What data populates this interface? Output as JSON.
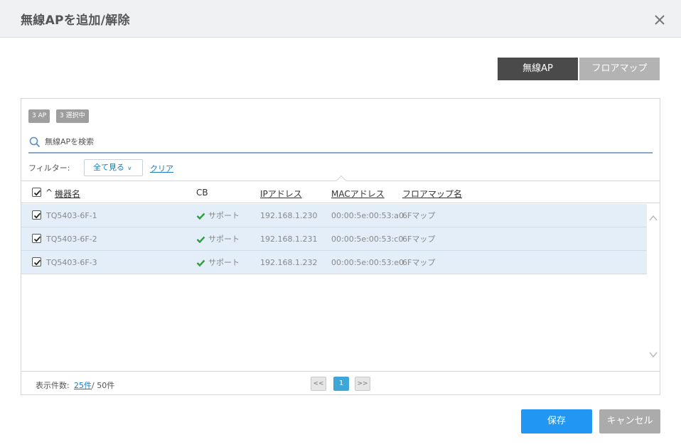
{
  "dialog": {
    "title": "無線APを追加/解除"
  },
  "tabs": [
    {
      "label": "無線AP",
      "active": true
    },
    {
      "label": "フロアマップ",
      "active": false
    }
  ],
  "badges": {
    "count": "3 AP",
    "selected": "3 選択中"
  },
  "search": {
    "placeholder": "無線APを検索",
    "value": ""
  },
  "filter": {
    "label": "フィルター:",
    "selected": "全て見る",
    "clear": "クリア"
  },
  "table": {
    "sort_indicator": "^",
    "columns": {
      "name": "機器名",
      "cb": "CB",
      "ip": "IPアドレス",
      "mac": "MACアドレス",
      "floormap": "フロアマップ名"
    },
    "rows": [
      {
        "checked": true,
        "name": "TQ5403-6F-1",
        "cb": "サポート",
        "ip": "192.168.1.230",
        "mac": "00:00:5e:00:53:a0",
        "floormap": "6Fマップ"
      },
      {
        "checked": true,
        "name": "TQ5403-6F-2",
        "cb": "サポート",
        "ip": "192.168.1.231",
        "mac": "00:00:5e:00:53:c0",
        "floormap": "6Fマップ"
      },
      {
        "checked": true,
        "name": "TQ5403-6F-3",
        "cb": "サポート",
        "ip": "192.168.1.232",
        "mac": "00:00:5e:00:53:e0",
        "floormap": "6Fマップ"
      }
    ]
  },
  "pagination": {
    "per_page_label": "表示件数:",
    "per_page": "25件",
    "total": "/ 50件",
    "prev": "<<",
    "current": "1",
    "next": ">>"
  },
  "actions": {
    "save": "保存",
    "cancel": "キャンセル"
  },
  "colors": {
    "primary": "#2196f3",
    "link": "#1b7bb8",
    "row_selected": "#e3eef8",
    "check_green": "#2e9e3e"
  }
}
